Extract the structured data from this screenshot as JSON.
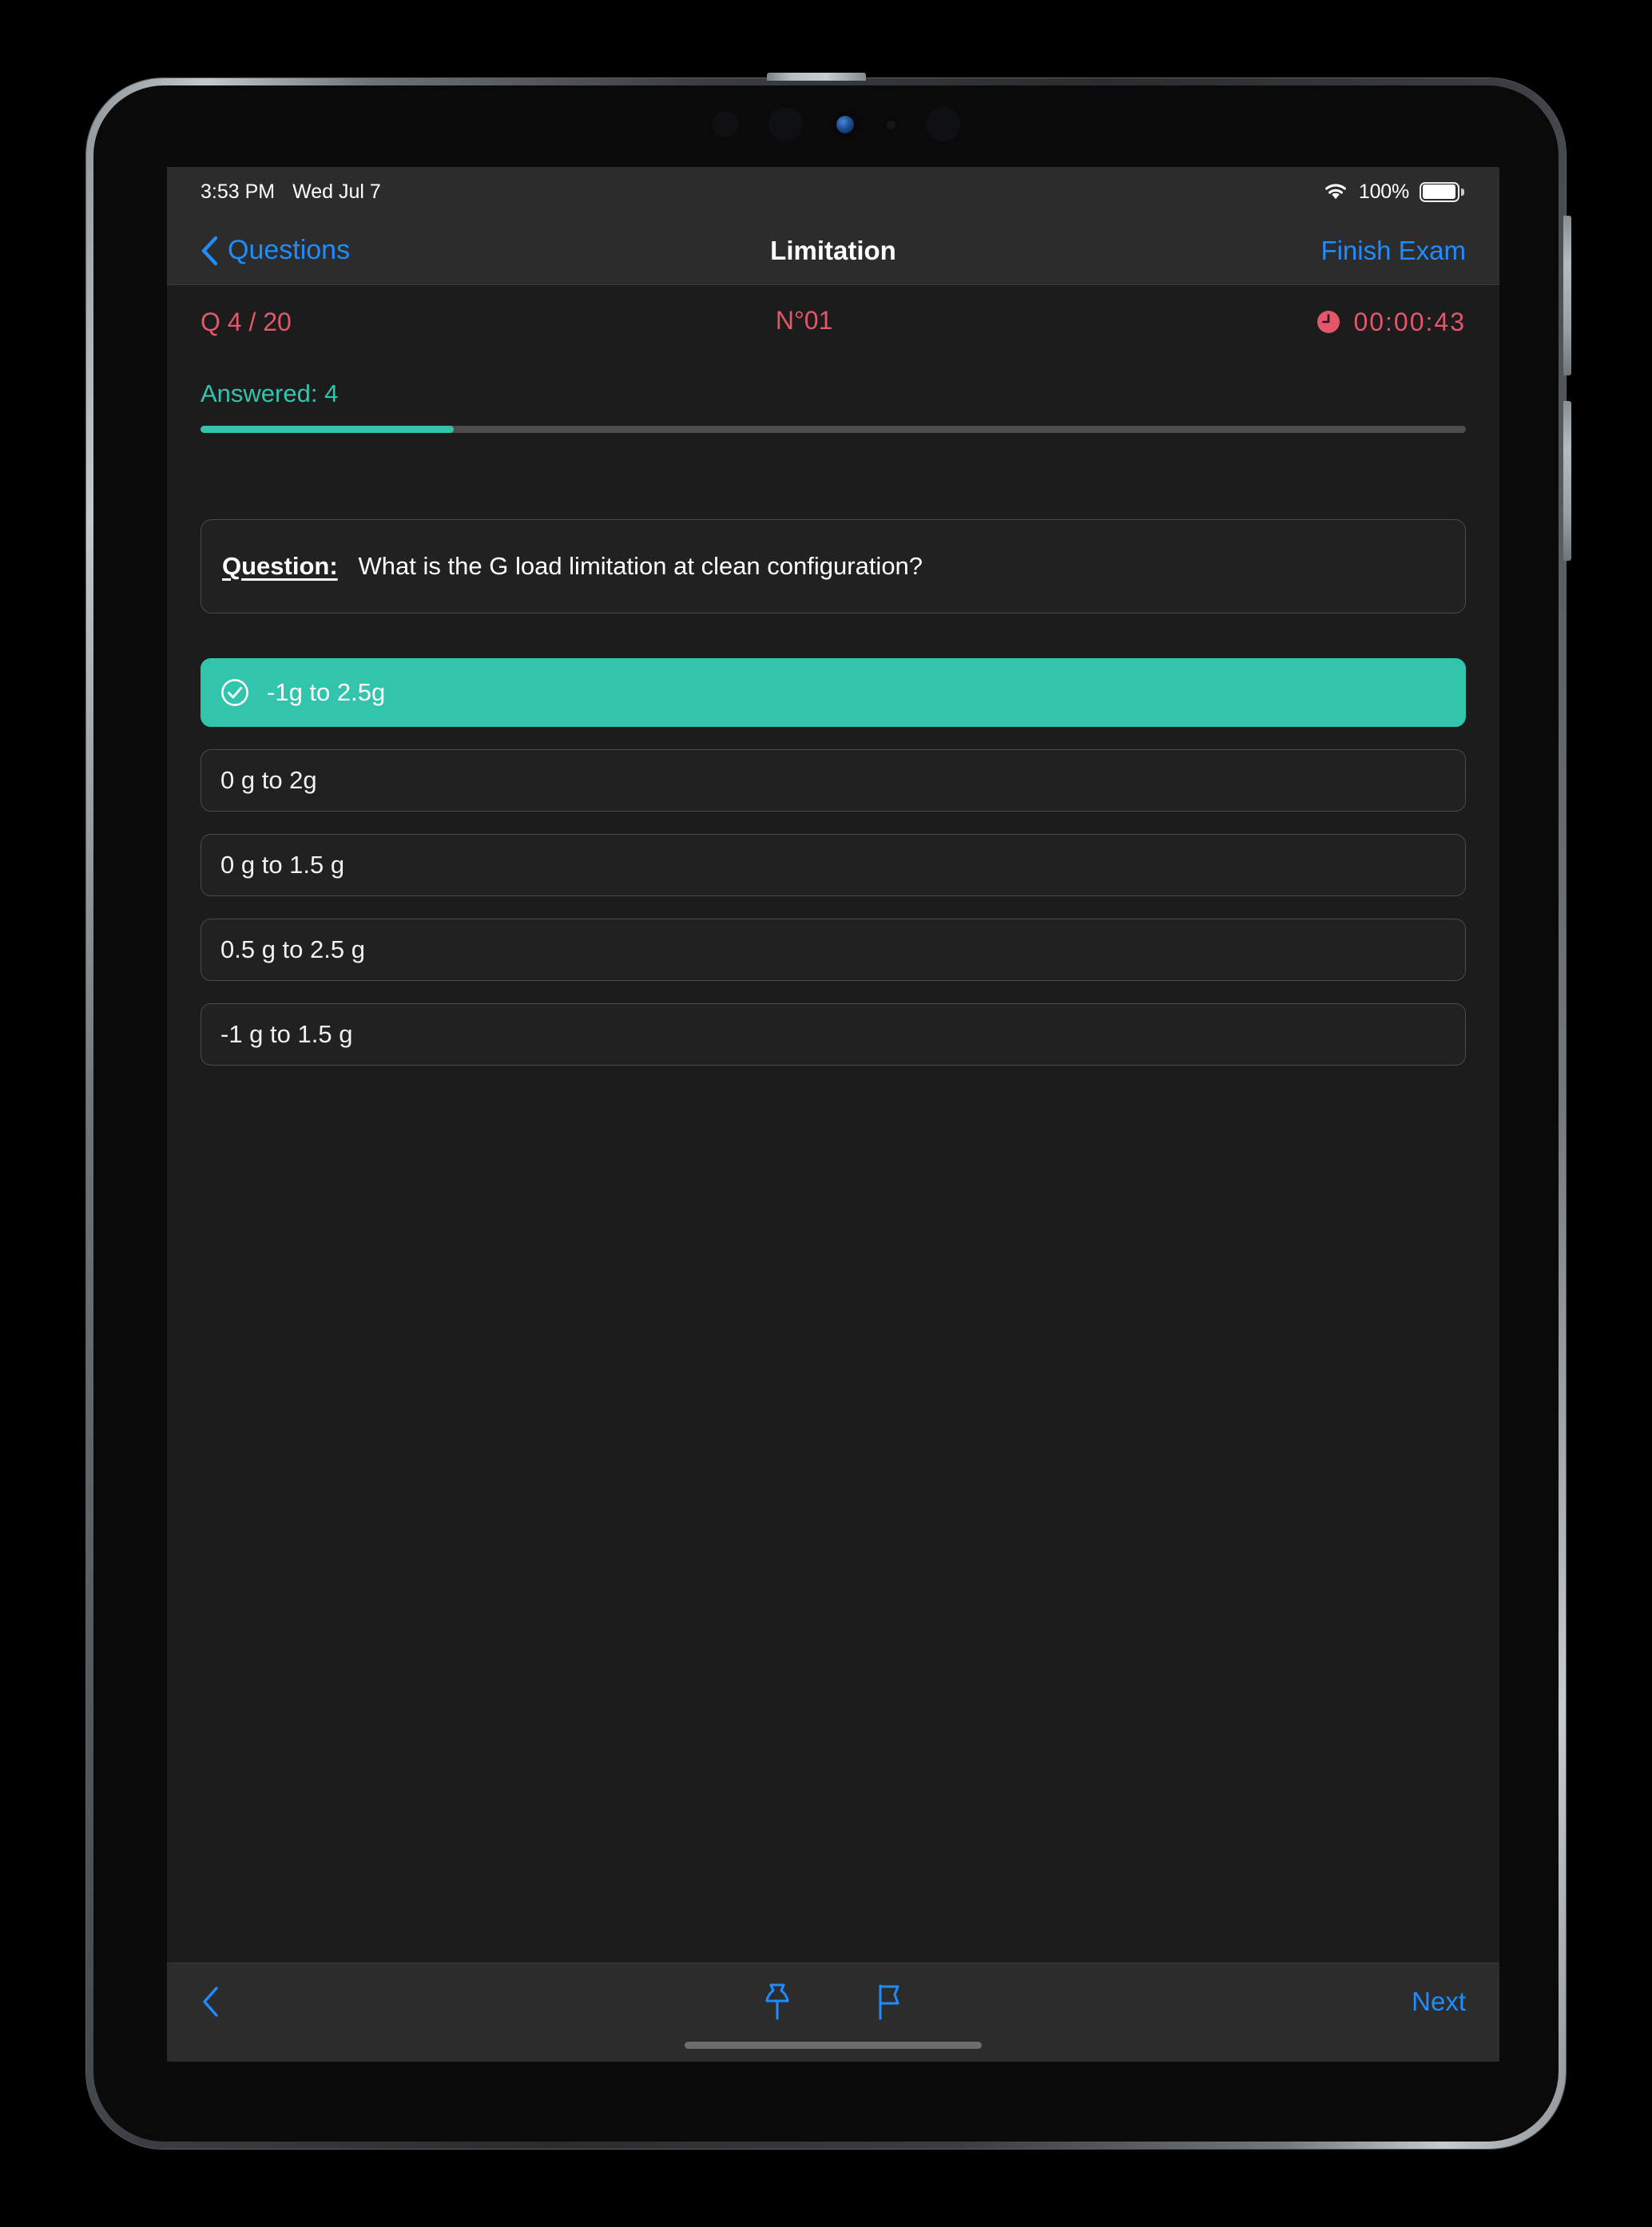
{
  "status_bar": {
    "time": "3:53 PM",
    "date": "Wed Jul 7",
    "wifi_icon": "wifi-icon",
    "battery_percent": "100%",
    "battery_icon": "battery-full-icon"
  },
  "nav_bar": {
    "back_icon": "chevron-left-icon",
    "back_label": "Questions",
    "title": "Limitation",
    "finish_label": "Finish Exam"
  },
  "info_row": {
    "question_counter": "Q 4 / 20",
    "question_number": "N°01",
    "timer_icon": "clock-icon",
    "timer": "00:00:43",
    "accent_color": "#e4566a"
  },
  "progress": {
    "answered_label": "Answered: 4",
    "answered_count": 4,
    "total_count": 20,
    "percent": 20,
    "accent_color": "#33c4ad"
  },
  "question": {
    "label": "Question:",
    "text": "What is the G load limitation at clean configuration?"
  },
  "options": [
    {
      "text": "-1g to 2.5g",
      "selected": true,
      "check_icon": "check-circle-icon"
    },
    {
      "text": "0 g to 2g",
      "selected": false
    },
    {
      "text": "0 g to 1.5 g",
      "selected": false
    },
    {
      "text": "0.5 g to 2.5 g",
      "selected": false
    },
    {
      "text": "-1 g to 1.5 g",
      "selected": false
    }
  ],
  "bottom_toolbar": {
    "back_icon": "chevron-left-icon",
    "pin_icon": "pin-icon",
    "flag_icon": "flag-icon",
    "next_label": "Next",
    "accent_color": "#1f8cff"
  }
}
